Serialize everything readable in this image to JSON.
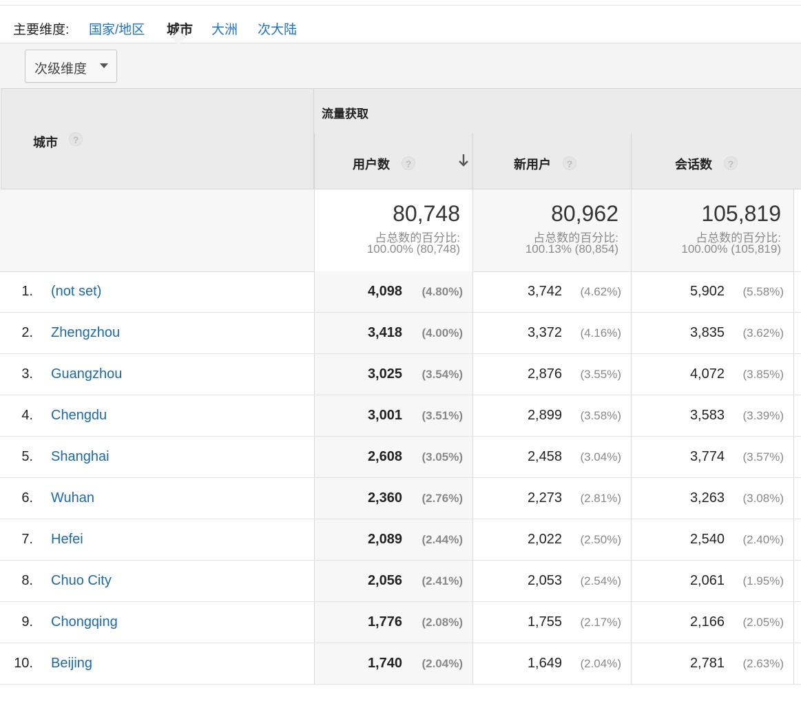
{
  "primary_dimension": {
    "label": "主要维度:",
    "options": [
      {
        "label": "国家/地区",
        "active": false
      },
      {
        "label": "城市",
        "active": true
      },
      {
        "label": "大洲",
        "active": false
      },
      {
        "label": "次大陆",
        "active": false
      }
    ]
  },
  "secondary_dimension": {
    "button_label": "次级维度"
  },
  "table": {
    "dimension_header": "城市",
    "group_header": "流量获取",
    "columns": [
      {
        "label": "用户数",
        "sorted": "desc"
      },
      {
        "label": "新用户"
      },
      {
        "label": "会话数"
      }
    ],
    "totals": [
      {
        "value": "80,748",
        "sub1": "占总数的百分比:",
        "sub2": "100.00% (80,748)"
      },
      {
        "value": "80,962",
        "sub1": "占总数的百分比:",
        "sub2": "100.13% (80,854)"
      },
      {
        "value": "105,819",
        "sub1": "占总数的百分比:",
        "sub2": "100.00% (105,819)"
      }
    ],
    "rows": [
      {
        "index": "1.",
        "city": "(not set)",
        "users": "4,098",
        "users_pct": "(4.80%)",
        "new_users": "3,742",
        "new_users_pct": "(4.62%)",
        "sessions": "5,902",
        "sessions_pct": "(5.58%)"
      },
      {
        "index": "2.",
        "city": "Zhengzhou",
        "users": "3,418",
        "users_pct": "(4.00%)",
        "new_users": "3,372",
        "new_users_pct": "(4.16%)",
        "sessions": "3,835",
        "sessions_pct": "(3.62%)"
      },
      {
        "index": "3.",
        "city": "Guangzhou",
        "users": "3,025",
        "users_pct": "(3.54%)",
        "new_users": "2,876",
        "new_users_pct": "(3.55%)",
        "sessions": "4,072",
        "sessions_pct": "(3.85%)"
      },
      {
        "index": "4.",
        "city": "Chengdu",
        "users": "3,001",
        "users_pct": "(3.51%)",
        "new_users": "2,899",
        "new_users_pct": "(3.58%)",
        "sessions": "3,583",
        "sessions_pct": "(3.39%)"
      },
      {
        "index": "5.",
        "city": "Shanghai",
        "users": "2,608",
        "users_pct": "(3.05%)",
        "new_users": "2,458",
        "new_users_pct": "(3.04%)",
        "sessions": "3,774",
        "sessions_pct": "(3.57%)"
      },
      {
        "index": "6.",
        "city": "Wuhan",
        "users": "2,360",
        "users_pct": "(2.76%)",
        "new_users": "2,273",
        "new_users_pct": "(2.81%)",
        "sessions": "3,263",
        "sessions_pct": "(3.08%)"
      },
      {
        "index": "7.",
        "city": "Hefei",
        "users": "2,089",
        "users_pct": "(2.44%)",
        "new_users": "2,022",
        "new_users_pct": "(2.50%)",
        "sessions": "2,540",
        "sessions_pct": "(2.40%)"
      },
      {
        "index": "8.",
        "city": "Chuo City",
        "users": "2,056",
        "users_pct": "(2.41%)",
        "new_users": "2,053",
        "new_users_pct": "(2.54%)",
        "sessions": "2,061",
        "sessions_pct": "(1.95%)"
      },
      {
        "index": "9.",
        "city": "Chongqing",
        "users": "1,776",
        "users_pct": "(2.08%)",
        "new_users": "1,755",
        "new_users_pct": "(2.17%)",
        "sessions": "2,166",
        "sessions_pct": "(2.05%)"
      },
      {
        "index": "10.",
        "city": "Beijing",
        "users": "1,740",
        "users_pct": "(2.04%)",
        "new_users": "1,649",
        "new_users_pct": "(2.04%)",
        "sessions": "2,781",
        "sessions_pct": "(2.63%)"
      }
    ]
  },
  "icons": {
    "help": "help-icon",
    "sort": "arrow-down-icon",
    "dropdown": "caret-down-icon"
  },
  "colors": {
    "link": "#1a73c8",
    "city_link": "#1a6aa8",
    "header_bg": "#ebebeb"
  }
}
